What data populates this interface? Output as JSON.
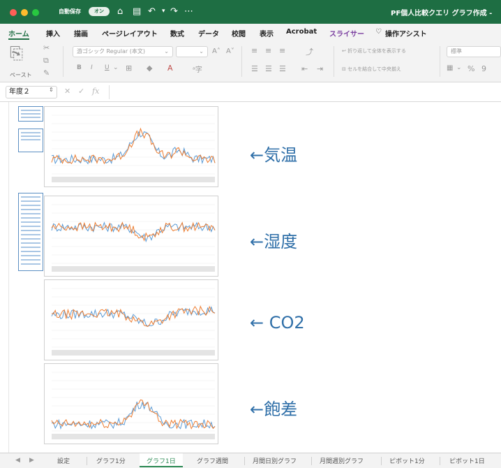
{
  "window": {
    "autosave_label": "自動保存",
    "autosave_state": "オン",
    "title": "PF個人比較クエリ グラフ作成 -"
  },
  "menu": [
    "ホーム",
    "挿入",
    "描画",
    "ページレイアウト",
    "数式",
    "データ",
    "校閲",
    "表示",
    "Acrobat",
    "スライサー",
    "操作アシスト"
  ],
  "ribbon": {
    "paste_label": "ペースト",
    "font_name": "游ゴシック Regular (本文)",
    "wrap_text": "折り返して全体を表示する",
    "merge_center": "セルを結合して中央揃え",
    "number_format": "標準"
  },
  "formula_bar": {
    "name_box": "年度２",
    "fx": "fx"
  },
  "annotations": [
    "←気温",
    "←湿度",
    "← CO2",
    "←飽差"
  ],
  "sheet_tabs": [
    "設定",
    "グラフ1分",
    "グラフ1日",
    "グラフ週間",
    "月間日別グラフ",
    "月間週別グラフ",
    "ピボット1分",
    "ピボット1日"
  ],
  "colors": {
    "excel_green": "#1e6e43",
    "series_blue": "#5b9bd5",
    "series_orange": "#ed7d31",
    "annotation_blue": "#2f6fa8"
  }
}
